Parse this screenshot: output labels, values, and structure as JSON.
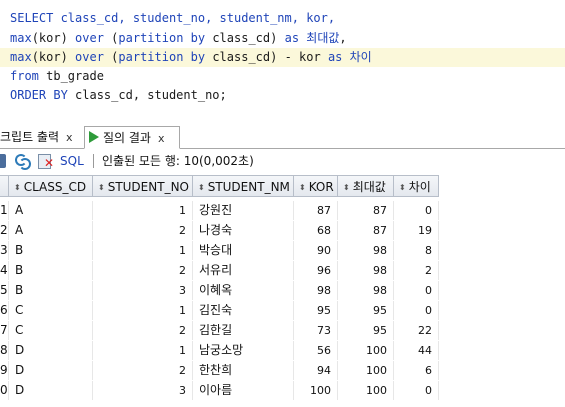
{
  "editor": {
    "line1": "SELECT class_cd, student_no, student_nm, kor,",
    "line2_kw1": "max",
    "line2_a": "(kor) ",
    "line2_kw2": "over",
    "line2_b": " (",
    "line2_kw3": "partition by",
    "line2_c": " class_cd) ",
    "line2_kw4": "as",
    "line2_alias": "최대값",
    "line2_end": ",",
    "line3_kw1": "max",
    "line3_a": "(kor) ",
    "line3_kw2": "over",
    "line3_b": " (",
    "line3_kw3": "partition by",
    "line3_c": " class_cd) - kor ",
    "line3_kw4": "as",
    "line3_alias": "차이",
    "line4_kw": "from",
    "line4_rest": " tb_grade",
    "line5_kw": "ORDER BY",
    "line5_rest": " class_cd, student_no;"
  },
  "tabs": {
    "script_output": "크립트 출력",
    "query_result": "질의 결과",
    "close_glyph": "x"
  },
  "toolbar": {
    "sql_label": "SQL",
    "status": "인출된 모든 행: 10(0,002초)"
  },
  "grid": {
    "columns": [
      "CLASS_CD",
      "STUDENT_NO",
      "STUDENT_NM",
      "KOR",
      "최대값",
      "차이"
    ],
    "rows": [
      {
        "rn": "1",
        "class_cd": "A",
        "student_no": "1",
        "student_nm": "강원진",
        "kor": "87",
        "max": "87",
        "diff": "0"
      },
      {
        "rn": "2",
        "class_cd": "A",
        "student_no": "2",
        "student_nm": "나경숙",
        "kor": "68",
        "max": "87",
        "diff": "19"
      },
      {
        "rn": "3",
        "class_cd": "B",
        "student_no": "1",
        "student_nm": "박승대",
        "kor": "90",
        "max": "98",
        "diff": "8"
      },
      {
        "rn": "4",
        "class_cd": "B",
        "student_no": "2",
        "student_nm": "서유리",
        "kor": "96",
        "max": "98",
        "diff": "2"
      },
      {
        "rn": "5",
        "class_cd": "B",
        "student_no": "3",
        "student_nm": "이혜옥",
        "kor": "98",
        "max": "98",
        "diff": "0"
      },
      {
        "rn": "6",
        "class_cd": "C",
        "student_no": "1",
        "student_nm": "김진숙",
        "kor": "95",
        "max": "95",
        "diff": "0"
      },
      {
        "rn": "7",
        "class_cd": "C",
        "student_no": "2",
        "student_nm": "김한길",
        "kor": "73",
        "max": "95",
        "diff": "22"
      },
      {
        "rn": "8",
        "class_cd": "D",
        "student_no": "1",
        "student_nm": "남궁소망",
        "kor": "56",
        "max": "100",
        "diff": "44"
      },
      {
        "rn": "9",
        "class_cd": "D",
        "student_no": "2",
        "student_nm": "한찬희",
        "kor": "94",
        "max": "100",
        "diff": "6"
      },
      {
        "rn": "0",
        "class_cd": "D",
        "student_no": "3",
        "student_nm": "이아름",
        "kor": "100",
        "max": "100",
        "diff": "0"
      }
    ]
  },
  "colors": {
    "keyword": "#1f44b8",
    "highlight_line": "#fbf8da",
    "run_icon": "#2e9b3a"
  },
  "icons": [
    "pin-icon",
    "refresh-icon",
    "export-icon",
    "play-icon",
    "sort-arrows-icon"
  ]
}
